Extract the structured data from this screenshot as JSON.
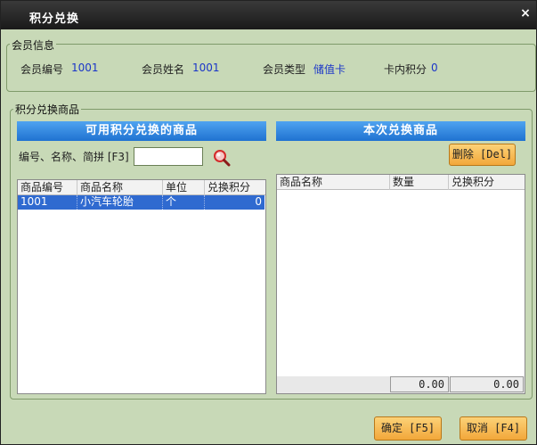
{
  "window": {
    "title": "积分兑换",
    "close_label": "×"
  },
  "member_info": {
    "legend": "会员信息",
    "id_label": "会员编号",
    "id_value": "1001",
    "name_label": "会员姓名",
    "name_value": "1001",
    "type_label": "会员类型",
    "type_value": "储值卡",
    "points_label": "卡内积分",
    "points_value": "0"
  },
  "exchange": {
    "legend": "积分兑换商品",
    "available_header": "可用积分兑换的商品",
    "current_header": "本次兑换商品",
    "search_label": "编号、名称、简拼 [F3]",
    "search_value": "",
    "delete_label": "删除 [Del]"
  },
  "available_table": {
    "columns": [
      "商品编号",
      "商品名称",
      "单位",
      "兑换积分"
    ],
    "rows": [
      {
        "code": "1001",
        "name": "小汽车轮胎",
        "unit": "个",
        "points": "0"
      }
    ]
  },
  "current_table": {
    "columns": [
      "商品名称",
      "数量",
      "兑换积分"
    ],
    "total_qty": "0.00",
    "total_points": "0.00"
  },
  "footer": {
    "confirm_label": "确定 [F5]",
    "cancel_label": "取消 [F4]"
  }
}
